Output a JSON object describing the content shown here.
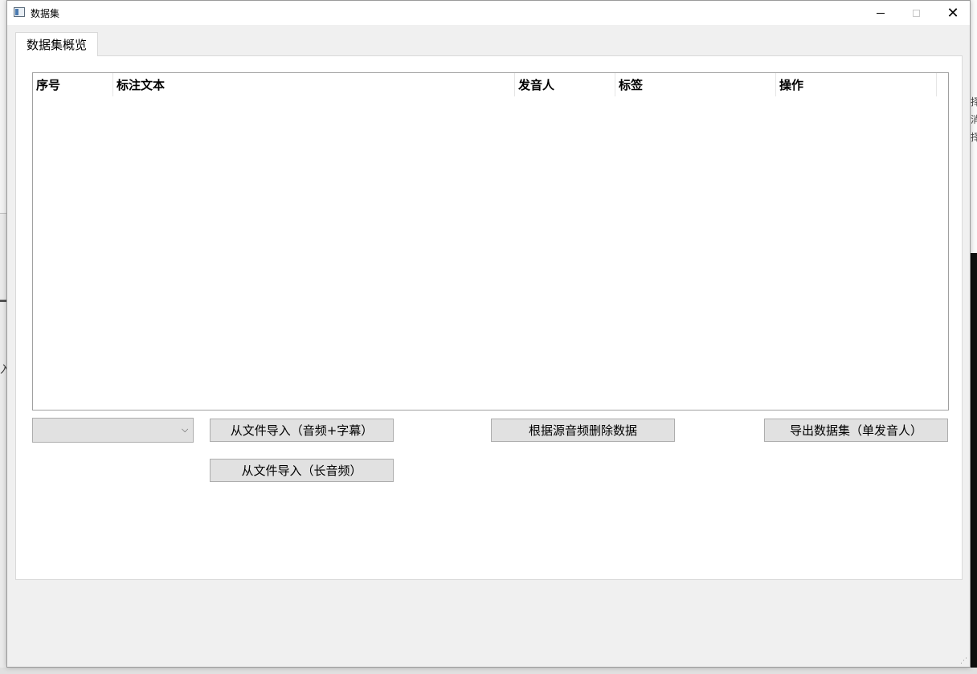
{
  "window": {
    "title": "数据集",
    "controls": {
      "minimize": "minimize",
      "maximize": "maximize",
      "close": "✕"
    }
  },
  "tabs": [
    {
      "label": "数据集概览",
      "selected": true
    }
  ],
  "table": {
    "columns": [
      "序号",
      "标注文本",
      "发音人",
      "标签",
      "操作"
    ],
    "rows": []
  },
  "controls": {
    "combo_value": "",
    "combo_arrow": "⌵",
    "import_subtitle_button": "从文件导入（音频+字幕）",
    "import_long_audio_button": "从文件导入（长音频）",
    "delete_by_source_button": "根据源音频删除数据",
    "export_single_speaker_button": "导出数据集（单发音人）"
  },
  "background": {
    "left_fragment": "入",
    "right_fragments": [
      "择",
      "消",
      "择"
    ]
  }
}
